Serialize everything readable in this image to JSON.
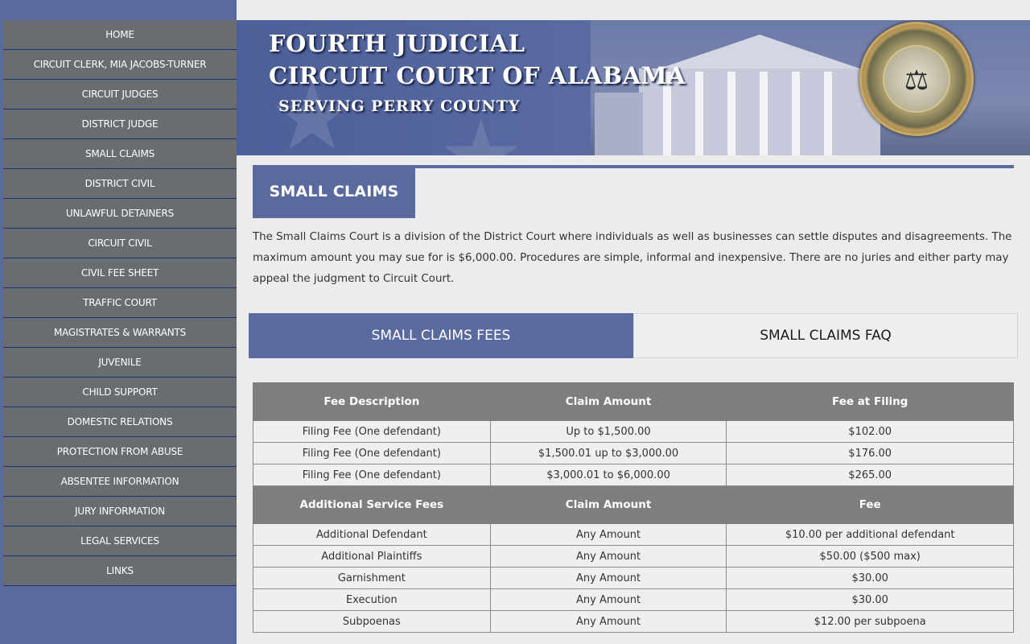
{
  "nav": {
    "items": [
      {
        "label": "HOME"
      },
      {
        "label": "CIRCUIT CLERK, MIA JACOBS-TURNER"
      },
      {
        "label": "CIRCUIT JUDGES"
      },
      {
        "label": "DISTRICT JUDGE"
      },
      {
        "label": "SMALL CLAIMS"
      },
      {
        "label": "DISTRICT CIVIL"
      },
      {
        "label": "UNLAWFUL DETAINERS"
      },
      {
        "label": "CIRCUIT CIVIL"
      },
      {
        "label": "CIVIL FEE SHEET"
      },
      {
        "label": "TRAFFIC COURT"
      },
      {
        "label": "MAGISTRATES & WARRANTS"
      },
      {
        "label": "JUVENILE"
      },
      {
        "label": "CHILD SUPPORT"
      },
      {
        "label": "DOMESTIC RELATIONS"
      },
      {
        "label": "PROTECTION FROM ABUSE"
      },
      {
        "label": "ABSENTEE INFORMATION"
      },
      {
        "label": "JURY INFORMATION"
      },
      {
        "label": "LEGAL SERVICES"
      },
      {
        "label": "LINKS"
      }
    ]
  },
  "banner": {
    "line1": "FOURTH  JUDICIAL",
    "line2": "CIRCUIT COURT OF ALABAMA",
    "line3": "SERVING  PERRY  COUNTY",
    "seal_icon": "unified-judicial-system-seal"
  },
  "section": {
    "title": "SMALL CLAIMS",
    "intro": "The Small Claims Court is a division of the District Court where individuals as well as businesses can settle disputes and disagreements. The maximum amount you may sue for is $6,000.00. Procedures are simple, informal and inexpensive. There are no juries and either party may appeal the judgment to Circuit Court."
  },
  "tabs": {
    "fees": "SMALL CLAIMS FEES",
    "faq": "SMALL CLAIMS FAQ",
    "active": "fees"
  },
  "fees_table": {
    "header1": [
      "Fee Description",
      "Claim Amount",
      "Fee at Filing"
    ],
    "rows1": [
      [
        "Filing Fee (One defendant)",
        "Up to $1,500.00",
        "$102.00"
      ],
      [
        "Filing Fee (One defendant)",
        "$1,500.01 up to $3,000.00",
        "$176.00"
      ],
      [
        "Filing Fee (One defendant)",
        "$3,000.01 to $6,000.00",
        "$265.00"
      ]
    ],
    "header2": [
      "Additional Service Fees",
      "Claim Amount",
      "Fee"
    ],
    "rows2": [
      [
        "Additional Defendant",
        "Any Amount",
        "$10.00 per additional defendant"
      ],
      [
        "Additional Plaintiffs",
        "Any Amount",
        "$50.00 ($500 max)"
      ],
      [
        "Garnishment",
        "Any Amount",
        "$30.00"
      ],
      [
        "Execution",
        "Any Amount",
        "$30.00"
      ],
      [
        "Subpoenas",
        "Any Amount",
        "$12.00 per subpoena"
      ]
    ]
  },
  "colors": {
    "accent": "#5a6a9e",
    "nav_bg": "#696d72",
    "table_header": "#7e7e7e",
    "page_bg": "#ececec"
  }
}
